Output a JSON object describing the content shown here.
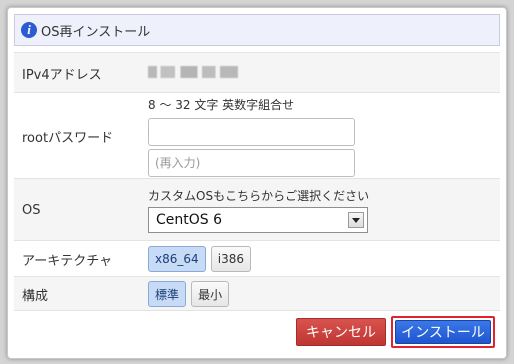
{
  "dialog": {
    "title": "OS再インストール"
  },
  "fields": {
    "ipv4": {
      "label": "IPv4アドレス",
      "value_obscured": true
    },
    "password": {
      "label": "rootパスワード",
      "hint": "8 〜 32 文字 英数字組合せ",
      "input1_value": "",
      "input2_placeholder": "(再入力)"
    },
    "os": {
      "label": "OS",
      "hint": "カスタムOSもこちらからご選択ください",
      "selected": "CentOS 6"
    },
    "arch": {
      "label": "アーキテクチャ",
      "options": [
        "x86_64",
        "i386"
      ],
      "selected": "x86_64"
    },
    "config": {
      "label": "構成",
      "options": [
        "標準",
        "最小"
      ],
      "selected": "標準"
    }
  },
  "buttons": {
    "cancel": "キャンセル",
    "install": "インストール"
  },
  "colors": {
    "cancel_bg": "#d9534f",
    "install_bg": "#2a64dc",
    "highlight_border": "#e0242f",
    "toggle_active": "#c7dbf6"
  }
}
